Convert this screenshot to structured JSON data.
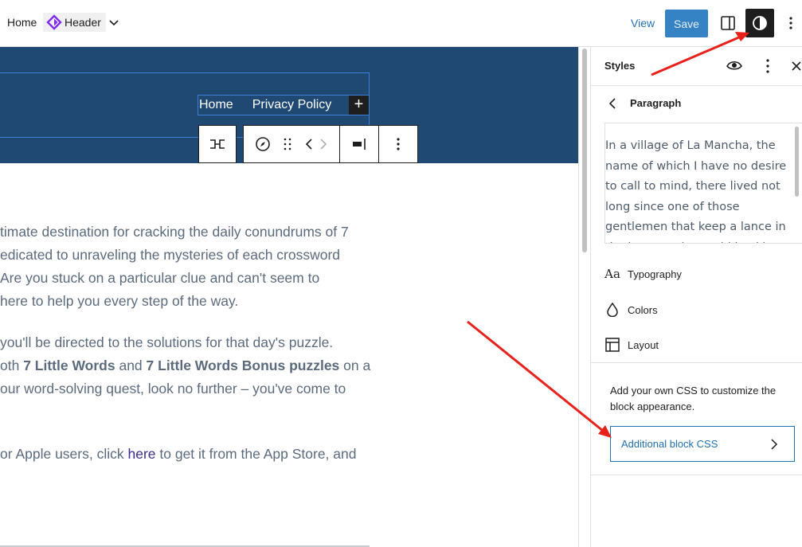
{
  "topbar": {
    "home_label": "Home",
    "template_label": "Header",
    "view_label": "View",
    "save_label": "Save"
  },
  "canvas": {
    "nav": {
      "home": "Home",
      "privacy": "Privacy Policy",
      "add_symbol": "+"
    },
    "paragraphs": [
      {
        "line1": "timate destination for cracking the daily conundrums of 7",
        "line2": "edicated to unraveling the mysteries of each crossword",
        "line3": "Are you stuck on a particular clue and can't seem to",
        "line4": "here to help you every step of the way."
      },
      {
        "line1": " you'll be directed to the solutions for that day's puzzle.",
        "line2_pre": "oth ",
        "line2_b1": "7 Little Words",
        "line2_mid": " and ",
        "line2_b2": "7 Little Words Bonus puzzles",
        "line2_post": " on a",
        "line3": "our word-solving quest, look no further – you've come to"
      },
      {
        "line1_pre": "or Apple users, click ",
        "line1_link": "here",
        "line1_post": " to get it from the App Store, and"
      }
    ]
  },
  "sidebar": {
    "title": "Styles",
    "section_title": "Paragraph",
    "preview_text": "In a village of La Mancha, the name of which I have no desire to call to mind, there lived not long since one of those gentlemen that keep a lance in the lance-rack, an old buckler",
    "typography_glyph": "Aa",
    "items": [
      {
        "label": "Typography"
      },
      {
        "label": "Colors"
      },
      {
        "label": "Layout"
      }
    ],
    "help_text": "Add your own CSS to customize the block appearance.",
    "css_button_label": "Additional block CSS"
  },
  "colors": {
    "hero_bg": "#1f4872",
    "accent": "#2271b1",
    "annotation_arrow": "#e8211b"
  }
}
